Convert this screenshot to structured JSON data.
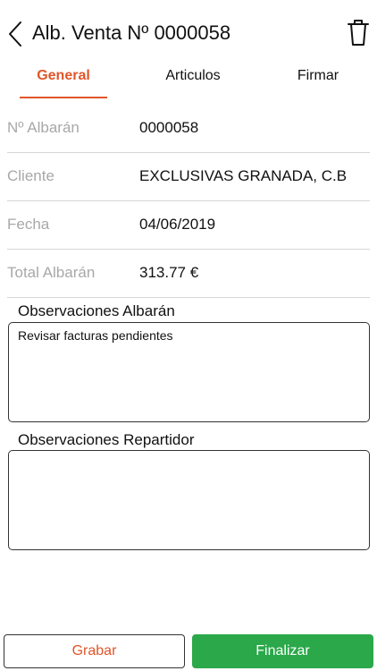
{
  "header": {
    "title": "Alb. Venta Nº 0000058",
    "back_icon": "chevron-left-icon",
    "delete_icon": "trash-icon"
  },
  "tabs": [
    {
      "label": "General",
      "active": true
    },
    {
      "label": "Articulos",
      "active": false
    },
    {
      "label": "Firmar",
      "active": false
    }
  ],
  "fields": [
    {
      "label": "Nº Albarán",
      "value": "0000058"
    },
    {
      "label": "Cliente",
      "value": "EXCLUSIVAS GRANADA, C.B"
    },
    {
      "label": "Fecha",
      "value": "04/06/2019"
    },
    {
      "label": "Total Albarán",
      "value": "313.77 €"
    }
  ],
  "observaciones_albaran": {
    "label": "Observaciones Albarán",
    "value": "Revisar facturas pendientes"
  },
  "observaciones_repartidor": {
    "label": "Observaciones Repartidor",
    "value": ""
  },
  "actions": {
    "grabar_label": "Grabar",
    "finalizar_label": "Finalizar"
  },
  "colors": {
    "accent": "#e0562a",
    "primary_button": "#2aa84a",
    "muted_label": "#a8a8a8",
    "divider": "#d6d6d6"
  }
}
